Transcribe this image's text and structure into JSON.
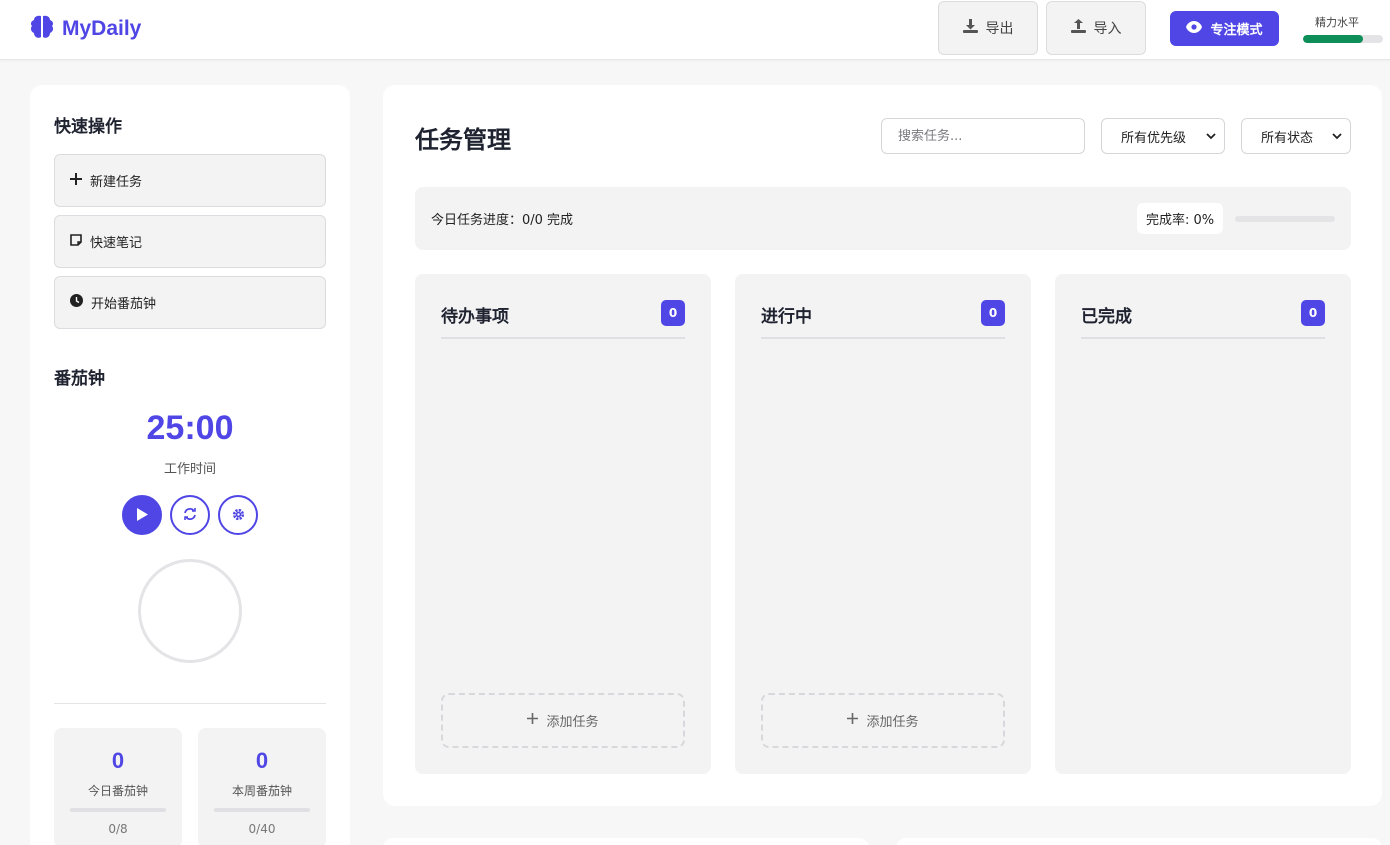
{
  "app": {
    "name": "MyDaily"
  },
  "header": {
    "export_label": "导出",
    "import_label": "导入",
    "focus_mode_label": "专注模式",
    "energy_label": "精力水平",
    "energy_level": 0.75
  },
  "sidebar": {
    "quick_actions_title": "快速操作",
    "quick_actions": [
      {
        "label": "新建任务",
        "icon": "plus-icon"
      },
      {
        "label": "快速笔记",
        "icon": "note-icon"
      },
      {
        "label": "开始番茄钟",
        "icon": "clock-icon"
      }
    ],
    "pomodoro": {
      "title": "番茄钟",
      "time": "25:00",
      "mode_label": "工作时间",
      "controls": [
        "play-icon",
        "refresh-icon",
        "settings-icon"
      ],
      "stats": [
        {
          "value": "0",
          "label": "今日番茄钟",
          "sub": "0/8"
        },
        {
          "value": "0",
          "label": "本周番茄钟",
          "sub": "0/40"
        }
      ]
    }
  },
  "main": {
    "title": "任务管理",
    "search_placeholder": "搜索任务...",
    "priority_filter": "所有优先级",
    "status_filter": "所有状态",
    "progress_text": "今日任务进度：0/0 完成",
    "completion_rate": "完成率: 0%",
    "completion_value": 0,
    "columns": [
      {
        "title": "待办事项",
        "count": "0",
        "add_label": "添加任务"
      },
      {
        "title": "进行中",
        "count": "0",
        "add_label": "添加任务"
      },
      {
        "title": "已完成",
        "count": "0"
      }
    ]
  },
  "colors": {
    "accent": "#4f46e5",
    "energy": "#0e8f5a"
  }
}
